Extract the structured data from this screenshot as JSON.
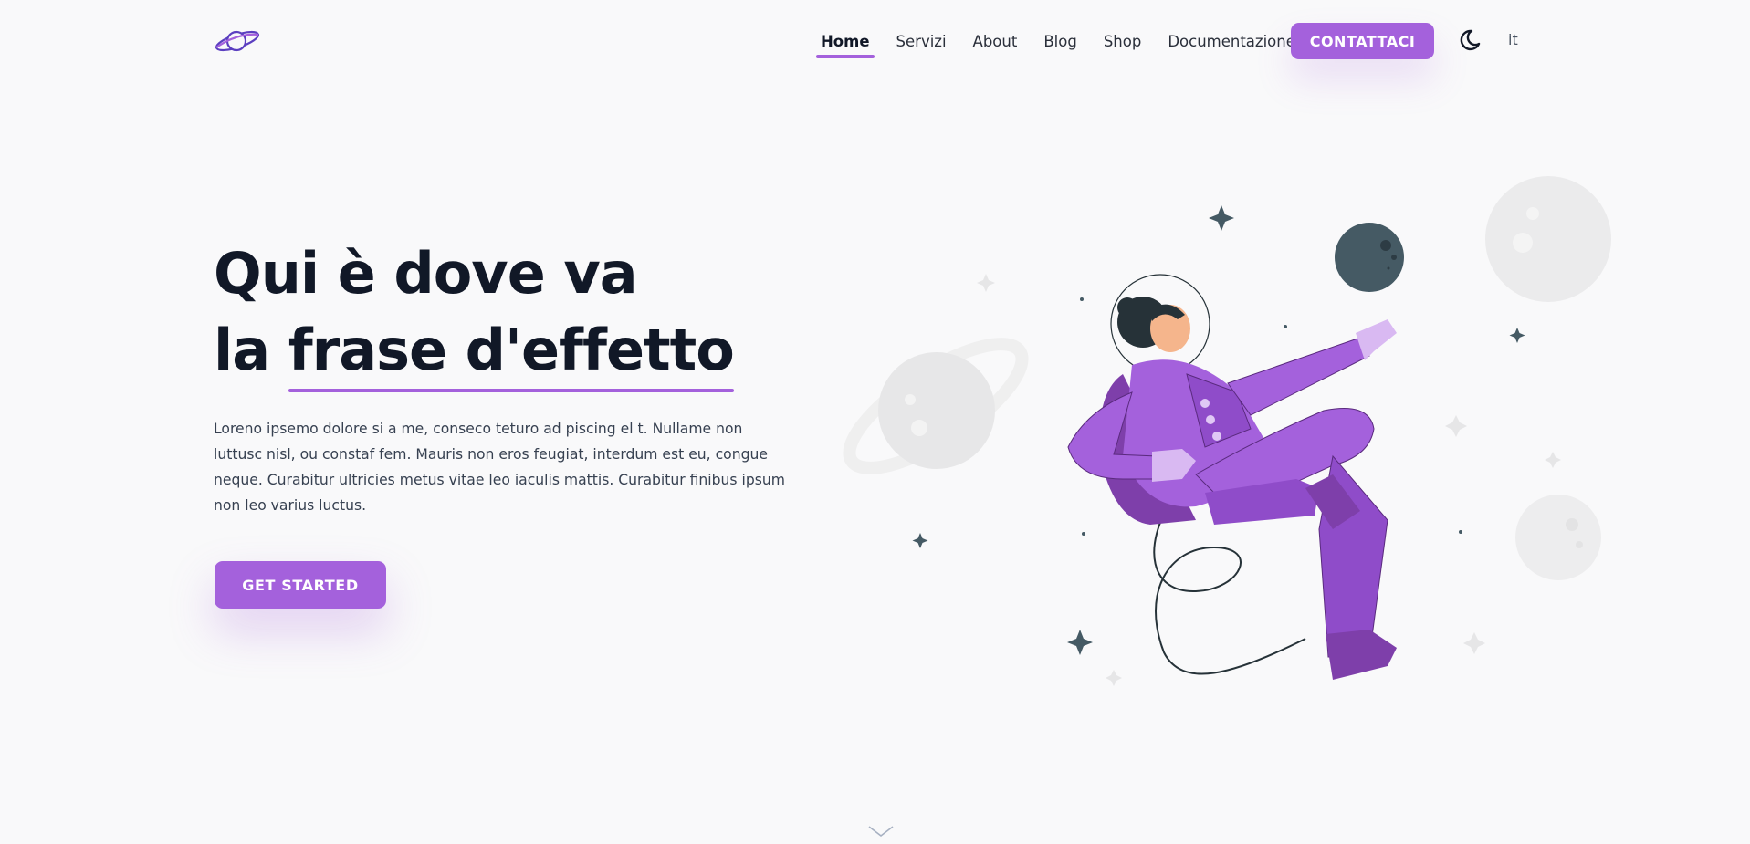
{
  "header": {
    "logo_icon": "planet-icon",
    "nav": [
      {
        "label": "Home",
        "active": true
      },
      {
        "label": "Servizi",
        "active": false
      },
      {
        "label": "About",
        "active": false
      },
      {
        "label": "Blog",
        "active": false
      },
      {
        "label": "Shop",
        "active": false
      },
      {
        "label": "Documentazione",
        "active": false
      }
    ],
    "contact_label": "CONTATTACI",
    "theme_icon": "moon-icon",
    "language": "it"
  },
  "hero": {
    "title_line1": "Qui è dove va",
    "title_line2_prefix": "la ",
    "title_line2_accent": "frase d'effetto",
    "text": "Loreno ipsemo dolore si a me, conseco teturo ad piscing el t. Nullame non luttusc nisl, ou constaf fem. Mauris non eros feugiat, interdum est eu, congue neque. Curabitur ultricies metus vitae leo iaculis mattis. Curabitur finibus ipsum non leo varius luctus.",
    "cta_label": "GET STARTED"
  },
  "illustration": "astronaut-illustration",
  "scroll_icon": "chevron-down-icon",
  "colors": {
    "accent": "#a461dc",
    "background": "#f9f9fa",
    "text": "#111827"
  }
}
